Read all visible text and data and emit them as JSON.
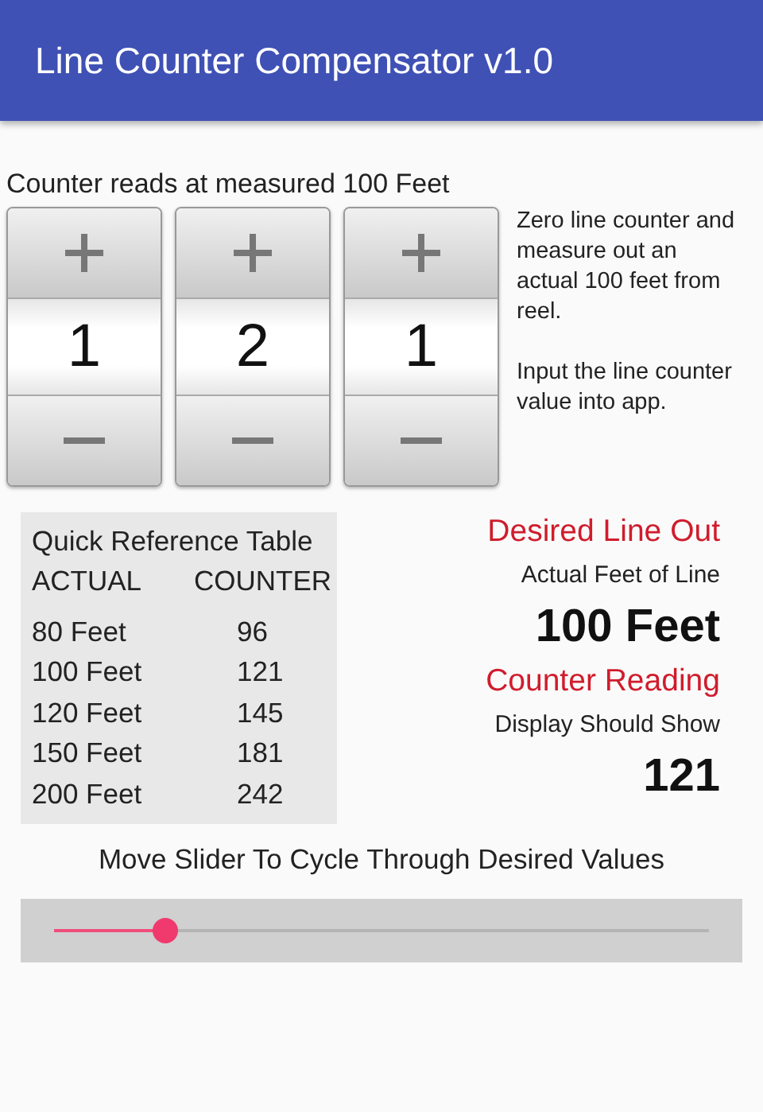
{
  "app_bar": {
    "title": "Line Counter Compensator v1.0"
  },
  "counter_caption": "Counter reads at measured 100 Feet",
  "digits": [
    {
      "value": "1"
    },
    {
      "value": "2"
    },
    {
      "value": "1"
    }
  ],
  "instructions": [
    "Zero line counter and measure out an actual 100 feet from reel.",
    "Input the line counter value into app."
  ],
  "reference_table": {
    "title": "Quick Reference Table",
    "columns": [
      "ACTUAL",
      "COUNTER"
    ],
    "rows": [
      [
        "80 Feet",
        "96"
      ],
      [
        "100 Feet",
        "121"
      ],
      [
        "120 Feet",
        "145"
      ],
      [
        "150 Feet",
        "181"
      ],
      [
        "200 Feet",
        "242"
      ]
    ]
  },
  "desired": {
    "heading": "Desired Line Out",
    "label": "Actual Feet of Line",
    "value": "100 Feet"
  },
  "counter_reading": {
    "heading": "Counter Reading",
    "label": "Display Should Show",
    "value": "121"
  },
  "slider": {
    "caption": "Move Slider To Cycle Through Desired Values",
    "level": 0.17
  }
}
